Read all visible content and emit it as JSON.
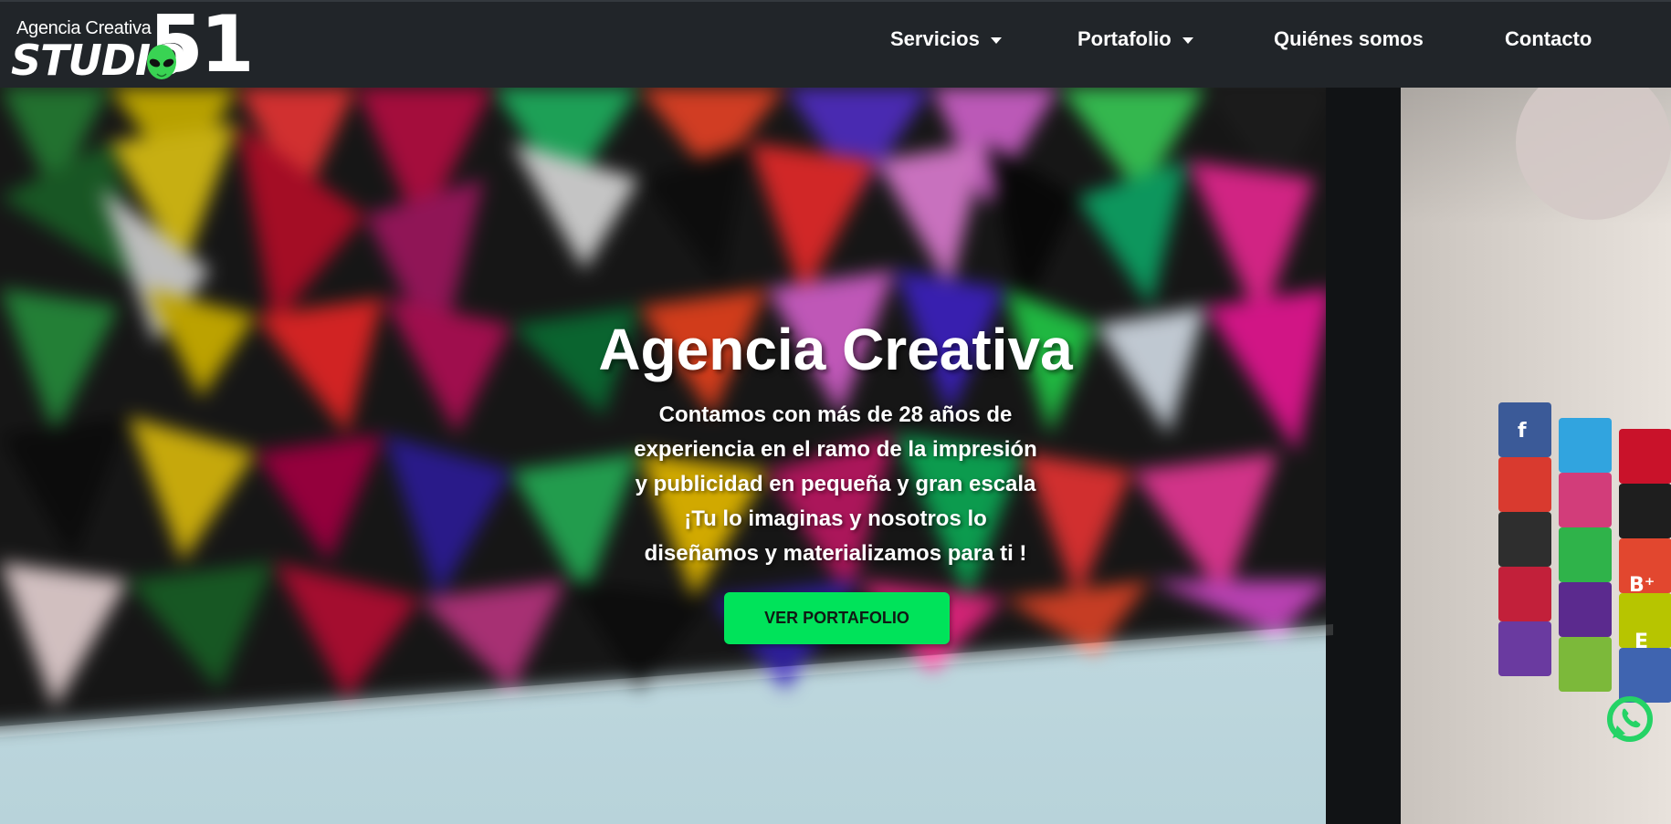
{
  "brand": {
    "tagline": "Agencia Creativa",
    "name": "STUDIO",
    "number": "51",
    "logo_icon": "alien-head-icon"
  },
  "nav": {
    "items": [
      {
        "label": "Servicios",
        "dropdown": true
      },
      {
        "label": "Portafolio",
        "dropdown": true
      },
      {
        "label": "Quiénes somos",
        "dropdown": false
      },
      {
        "label": "Contacto",
        "dropdown": false
      }
    ]
  },
  "hero": {
    "title": "Agencia Creativa",
    "lines": [
      "Contamos con más de 28 años de",
      "experiencia en el ramo de la impresión",
      "y publicidad en pequeña y gran escala",
      "¡Tu lo imaginas y nosotros lo",
      "diseñamos y materializamos para ti !"
    ],
    "cta_label": "VER PORTAFOLIO"
  },
  "floating": {
    "whatsapp_icon": "whatsapp-icon"
  },
  "colors": {
    "navbar": "#212529",
    "cta": "#00e35a",
    "whatsapp": "#25d366"
  }
}
